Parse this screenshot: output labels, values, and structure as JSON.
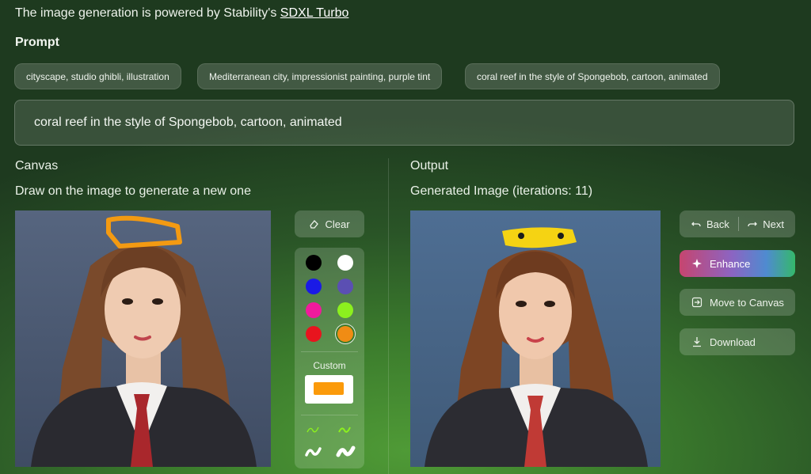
{
  "header": {
    "powered_text": "The image generation is powered by Stability's ",
    "powered_link": "SDXL Turbo"
  },
  "prompt": {
    "label": "Prompt",
    "chips": [
      "cityscape, studio ghibli, illustration",
      "Mediterranean city, impressionist painting, purple tint",
      "coral reef in the style of Spongebob, cartoon, animated"
    ],
    "value": "coral reef in the style of Spongebob, cartoon, animated"
  },
  "canvas": {
    "title": "Canvas",
    "subtitle": "Draw on the image to generate a new one",
    "clear_label": "Clear",
    "colors": [
      "#000000",
      "#ffffff",
      "#1a1ae6",
      "#5b4fb3",
      "#f01a9c",
      "#8cf01e",
      "#e8141e",
      "#f08c14"
    ],
    "selected_color": "#f08c14",
    "custom_label": "Custom",
    "custom_color": "#fb9a0b"
  },
  "output": {
    "title": "Output",
    "subtitle": "Generated Image (iterations: 11)",
    "back_label": "Back",
    "next_label": "Next",
    "enhance_label": "Enhance",
    "move_label": "Move to Canvas",
    "download_label": "Download"
  }
}
